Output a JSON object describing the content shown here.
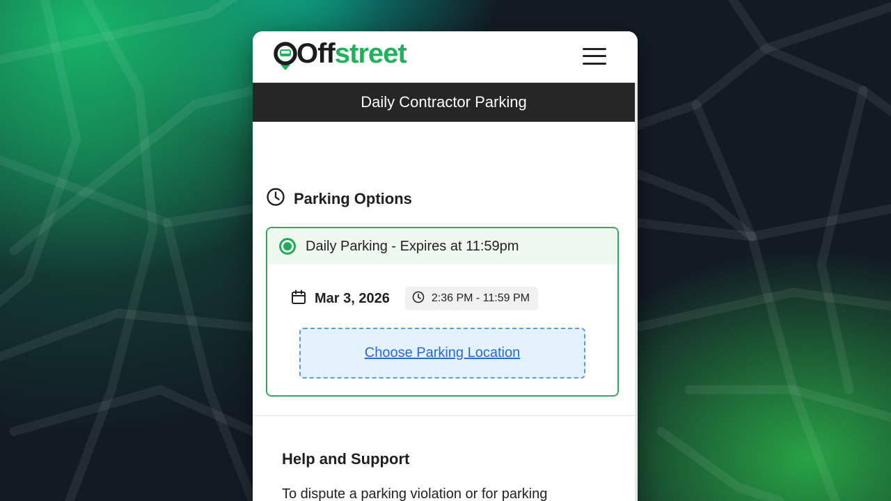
{
  "brand": {
    "logo_text_dark": "Off",
    "logo_text_green": "street",
    "accent_color": "#1db35a"
  },
  "header": {
    "menu_icon": "hamburger-menu-icon"
  },
  "page": {
    "title": "Daily Contractor Parking"
  },
  "parking_options": {
    "heading": "Parking Options",
    "heading_icon": "clock-icon",
    "option": {
      "label": "Daily Parking - Expires at 11:59pm",
      "selected": true,
      "date_icon": "calendar-icon",
      "date": "Mar 3, 2026",
      "time_icon": "clock-icon",
      "time_range": "2:36 PM - 11:59 PM",
      "choose_location_label": "Choose Parking Location"
    }
  },
  "help": {
    "heading": "Help and Support",
    "text": "To dispute a parking violation or for parking"
  }
}
